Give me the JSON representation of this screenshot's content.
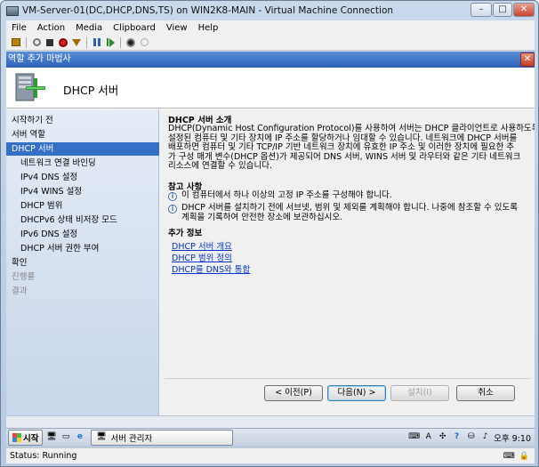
{
  "window": {
    "title": "VM-Server-01(DC,DHCP,DNS,TS) on WIN2K8-MAIN - Virtual Machine Connection",
    "controls": {
      "minimize": "–",
      "maximize": "□",
      "close": "✕"
    }
  },
  "menu": [
    "File",
    "Action",
    "Media",
    "Clipboard",
    "View",
    "Help"
  ],
  "toolbar": [
    "ctrl-alt-del-icon",
    "start-icon",
    "turn-off-icon",
    "shutdown-icon",
    "save-icon",
    "pause-icon",
    "resume-icon",
    "reset-icon",
    "snapshot-icon",
    "revert-icon"
  ],
  "wizard": {
    "title": "역할 추가 마법사",
    "header_title": "DHCP 서버",
    "nav": [
      {
        "label": "시작하기 전",
        "level": "top",
        "state": "normal"
      },
      {
        "label": "서버 역할",
        "level": "top",
        "state": "normal"
      },
      {
        "label": "DHCP 서버",
        "level": "top",
        "state": "selected"
      },
      {
        "label": "네트워크 연결 바인딩",
        "level": "sub",
        "state": "normal"
      },
      {
        "label": "IPv4 DNS 설정",
        "level": "sub",
        "state": "normal"
      },
      {
        "label": "IPv4 WINS 설정",
        "level": "sub",
        "state": "normal"
      },
      {
        "label": "DHCP 범위",
        "level": "sub",
        "state": "normal"
      },
      {
        "label": "DHCPv6 상태 비저장 모드",
        "level": "sub",
        "state": "normal"
      },
      {
        "label": "IPv6 DNS 설정",
        "level": "sub",
        "state": "normal"
      },
      {
        "label": "DHCP 서버 권한 부여",
        "level": "sub",
        "state": "normal"
      },
      {
        "label": "확인",
        "level": "top",
        "state": "normal"
      },
      {
        "label": "진행률",
        "level": "top",
        "state": "disabled"
      },
      {
        "label": "결과",
        "level": "top",
        "state": "disabled"
      }
    ],
    "content": {
      "intro_heading": "DHCP 서버 소개",
      "intro_lines": [
        "DHCP(Dynamic Host Configuration Protocol)를 사용하여 서버는 DHCP 클라이언트로 사용하도록",
        "설정된 컴퓨터 및 기타 장치에 IP 주소를 할당하거나 임대할 수 있습니다. 네트워크에 DHCP 서버를",
        "배포하면 컴퓨터 및 기타 TCP/IP 기반 네트워크 장치에 유효한 IP 주소 및 이러한 장치에 필요한 추",
        "가 구성 매개 변수(DHCP 옵션)가 제공되어 DNS 서버, WINS 서버 및 라우터와 같은 기타 네트워크",
        "리소스에 연결할 수 있습니다."
      ],
      "notes_heading": "참고 사항",
      "notes": [
        [
          "이 컴퓨터에서 하나 이상의 고정 IP 주소를 구성해야 합니다."
        ],
        [
          "DHCP 서버를 설치하기 전에 서브넷, 범위 및 제외를 계획해야 합니다. 나중에 참조할 수 있도록",
          "계획을 기록하여 안전한 장소에 보관하십시오."
        ]
      ],
      "more_heading": "추가 정보",
      "links": [
        "DHCP 서버 개요",
        "DHCP 범위 정의",
        "DHCP를 DNS와 통합"
      ]
    },
    "buttons": {
      "prev": "< 이전(P)",
      "next": "다음(N) >",
      "install": "설치(I)",
      "cancel": "취소"
    }
  },
  "taskbar": {
    "start": "시작",
    "task": "서버 관리자",
    "time": "오후 9:10"
  },
  "status": {
    "text": "Status: Running"
  }
}
